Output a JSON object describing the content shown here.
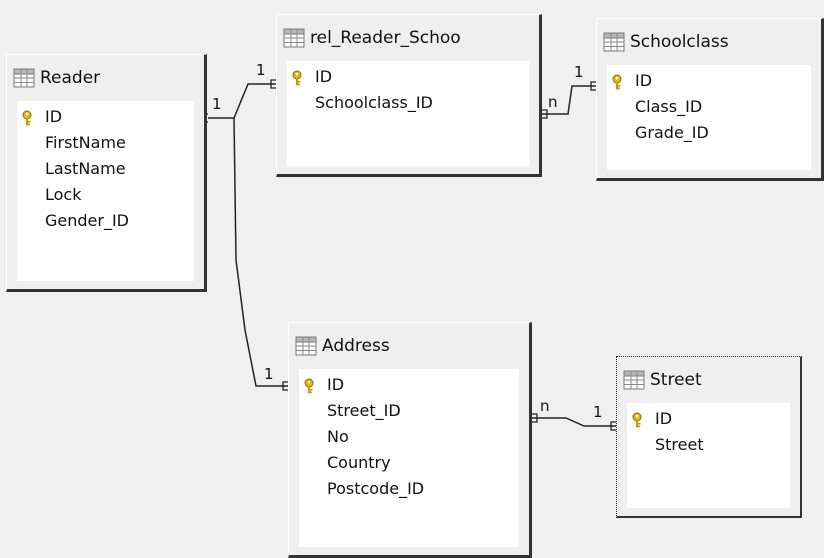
{
  "tables": [
    {
      "id": "reader",
      "title": "Reader",
      "fields": [
        {
          "name": "ID",
          "primary_key": true
        },
        {
          "name": "FirstName",
          "primary_key": false
        },
        {
          "name": "LastName",
          "primary_key": false
        },
        {
          "name": "Lock",
          "primary_key": false
        },
        {
          "name": "Gender_ID",
          "primary_key": false
        }
      ]
    },
    {
      "id": "rel",
      "title": "rel_Reader_Schoo",
      "fields": [
        {
          "name": "ID",
          "primary_key": true
        },
        {
          "name": "Schoolclass_ID",
          "primary_key": false
        }
      ]
    },
    {
      "id": "schoolclass",
      "title": "Schoolclass",
      "fields": [
        {
          "name": "ID",
          "primary_key": true
        },
        {
          "name": "Class_ID",
          "primary_key": false
        },
        {
          "name": "Grade_ID",
          "primary_key": false
        }
      ]
    },
    {
      "id": "address",
      "title": "Address",
      "fields": [
        {
          "name": "ID",
          "primary_key": true
        },
        {
          "name": "Street_ID",
          "primary_key": false
        },
        {
          "name": "No",
          "primary_key": false
        },
        {
          "name": "Country",
          "primary_key": false
        },
        {
          "name": "Postcode_ID",
          "primary_key": false
        }
      ]
    },
    {
      "id": "street",
      "title": "Street",
      "fields": [
        {
          "name": "ID",
          "primary_key": true
        },
        {
          "name": "Street",
          "primary_key": false
        }
      ]
    }
  ],
  "relations": [
    {
      "from": "Reader.ID",
      "to": "rel_Reader_Schoo.ID",
      "from_card": "1",
      "to_card": "1"
    },
    {
      "from": "rel_Reader_Schoo.Schoolclass_ID",
      "to": "Schoolclass.ID",
      "from_card": "n",
      "to_card": "1"
    },
    {
      "from": "Reader.ID",
      "to": "Address.ID",
      "from_card": "1",
      "to_card": "1"
    },
    {
      "from": "Address.Street_ID",
      "to": "Street.ID",
      "from_card": "n",
      "to_card": "1"
    }
  ],
  "colors": {
    "background": "#f0f0f0",
    "table_face": "#efefef",
    "table_shadow": "#333333",
    "key_icon": "#e0b000",
    "table_icon": "#7a7a7a"
  },
  "icons": {
    "table": "table-grid-icon",
    "primary_key": "key-icon"
  }
}
